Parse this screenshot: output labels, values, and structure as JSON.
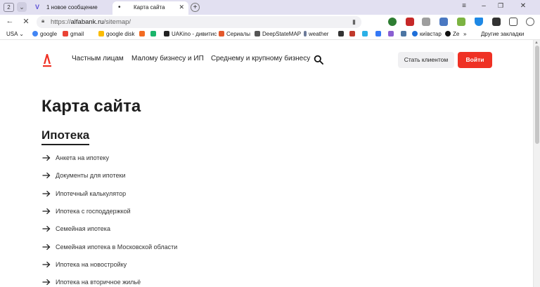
{
  "browser": {
    "tab_count": "2",
    "tabs": [
      {
        "title": "1 новое сообщение",
        "favicon": "V"
      },
      {
        "title": "Карта сайта"
      }
    ],
    "url_prefix": "https://",
    "url_host": "alfabank.ru",
    "url_path": "/sitemap/",
    "bookmarks": [
      {
        "label": "USA",
        "icon": "flag-icon",
        "color": "#3a6fd8"
      },
      {
        "label": "google",
        "icon": "google-icon",
        "color": "#4285f4"
      },
      {
        "label": "gmail",
        "icon": "gmail-icon",
        "color": "#ea4335"
      },
      {
        "label": "google disk",
        "icon": "drive-icon",
        "color": "#fbbc04"
      },
      {
        "label": "",
        "icon": "app-icon",
        "color": "#f26b21"
      },
      {
        "label": "",
        "icon": "app-icon",
        "color": "#1bb56b"
      },
      {
        "label": "UAKino - дивитис",
        "icon": "uakino-icon",
        "color": "#222222"
      },
      {
        "label": "Сериалы",
        "icon": "series-icon",
        "color": "#e3582b"
      },
      {
        "label": "DeepStateMAP",
        "icon": "map-icon",
        "color": "#555555"
      },
      {
        "label": "weather",
        "icon": "weather-icon",
        "color": "#6b7a99"
      },
      {
        "label": "",
        "icon": "app-icon",
        "color": "#333333"
      },
      {
        "label": "",
        "icon": "app-icon",
        "color": "#c0392b"
      },
      {
        "label": "",
        "icon": "app-icon",
        "color": "#2bb0e6"
      },
      {
        "label": "",
        "icon": "app-icon",
        "color": "#3478f6"
      },
      {
        "label": "",
        "icon": "app-icon",
        "color": "#8a5fd2"
      },
      {
        "label": "",
        "icon": "vk-icon",
        "color": "#4c75a3"
      },
      {
        "label": "київстар",
        "icon": "kyivstar-icon",
        "color": "#1e6fd9"
      },
      {
        "label": "Ze",
        "icon": "ze-icon",
        "color": "#111111"
      }
    ],
    "other_bookmarks": "Другие закладки"
  },
  "site": {
    "brand_color": "#ef3124",
    "nav": [
      "Частным лицам",
      "Малому бизнесу и ИП",
      "Среднему и крупному бизнесу"
    ],
    "become_client": "Стать клиентом",
    "login": "Войти"
  },
  "content": {
    "title": "Карта сайта",
    "section": "Ипотека",
    "links": [
      "Анкета на ипотеку",
      "Документы для ипотеки",
      "Ипотечный калькулятор",
      "Ипотека с господдержкой",
      "Семейная ипотека",
      "Семейная ипотека в Московской области",
      "Ипотека на новостройку",
      "Ипотека на вторичное жильё"
    ]
  }
}
